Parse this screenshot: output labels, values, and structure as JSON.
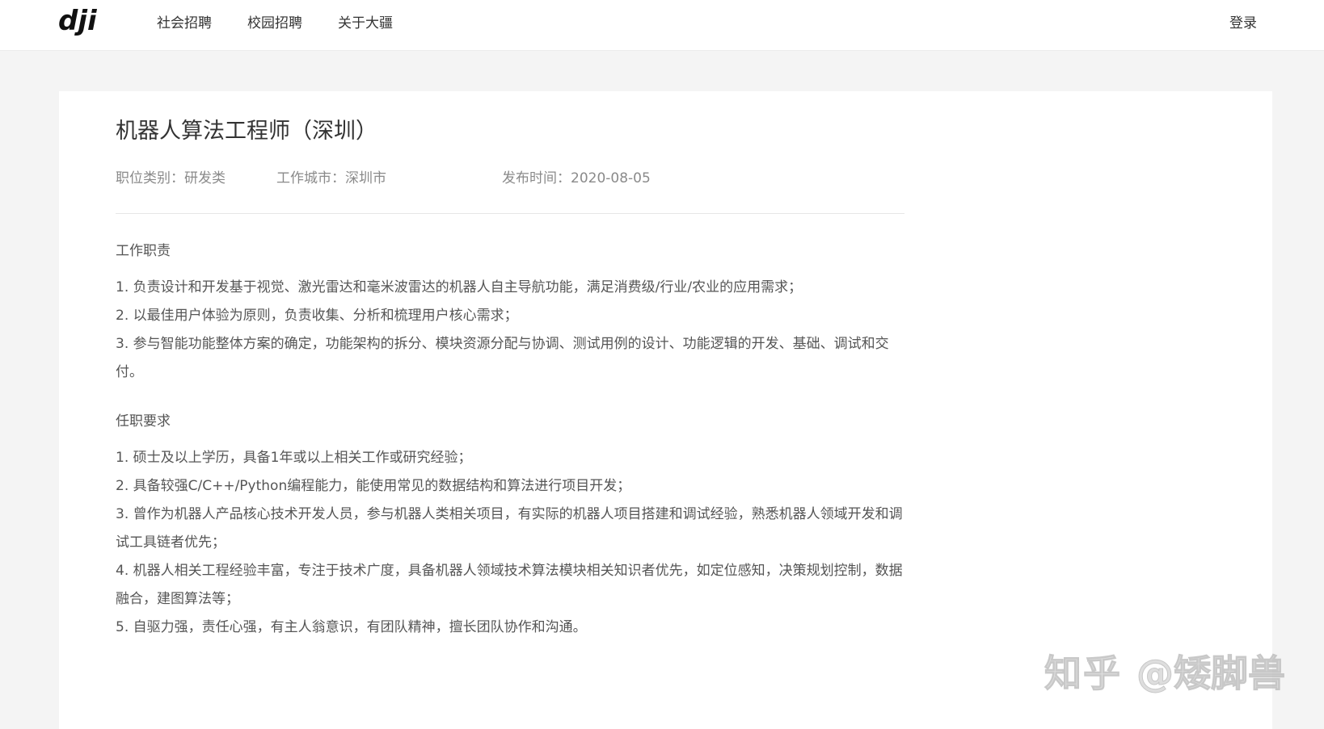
{
  "header": {
    "logo_text": "dji",
    "nav": [
      {
        "label": "社会招聘"
      },
      {
        "label": "校园招聘"
      },
      {
        "label": "关于大疆"
      }
    ],
    "login_label": "登录"
  },
  "job": {
    "title": "机器人算法工程师（深圳）",
    "category": "职位类别：研发类",
    "city": "工作城市：深圳市",
    "published": "发布时间：2020-08-05"
  },
  "responsibilities": {
    "heading": "工作职责",
    "items": [
      "1. 负责设计和开发基于视觉、激光雷达和毫米波雷达的机器人自主导航功能，满足消费级/行业/农业的应用需求；",
      "2. 以最佳用户体验为原则，负责收集、分析和梳理用户核心需求；",
      "3. 参与智能功能整体方案的确定，功能架构的拆分、模块资源分配与协调、测试用例的设计、功能逻辑的开发、基础、调试和交付。"
    ]
  },
  "requirements": {
    "heading": "任职要求",
    "items": [
      "1. 硕士及以上学历，具备1年或以上相关工作或研究经验；",
      "2. 具备较强C/C++/Python编程能力，能使用常见的数据结构和算法进行项目开发；",
      "3. 曾作为机器人产品核心技术开发人员，参与机器人类相关项目，有实际的机器人项目搭建和调试经验，熟悉机器人领域开发和调试工具链者优先；",
      "4. 机器人相关工程经验丰富，专注于技术广度，具备机器人领域技术算法模块相关知识者优先，如定位感知，决策规划控制，数据融合，建图算法等；",
      "5. 自驱力强，责任心强，有主人翁意识，有团队精神，擅长团队协作和沟通。"
    ]
  },
  "watermark": {
    "site": "知乎",
    "user": "@矮脚兽"
  },
  "colors": {
    "page_bg": "#f4f4f4",
    "card_bg": "#ffffff",
    "text_primary": "#333333",
    "text_secondary": "#555555",
    "text_meta": "#8a8a8a"
  }
}
